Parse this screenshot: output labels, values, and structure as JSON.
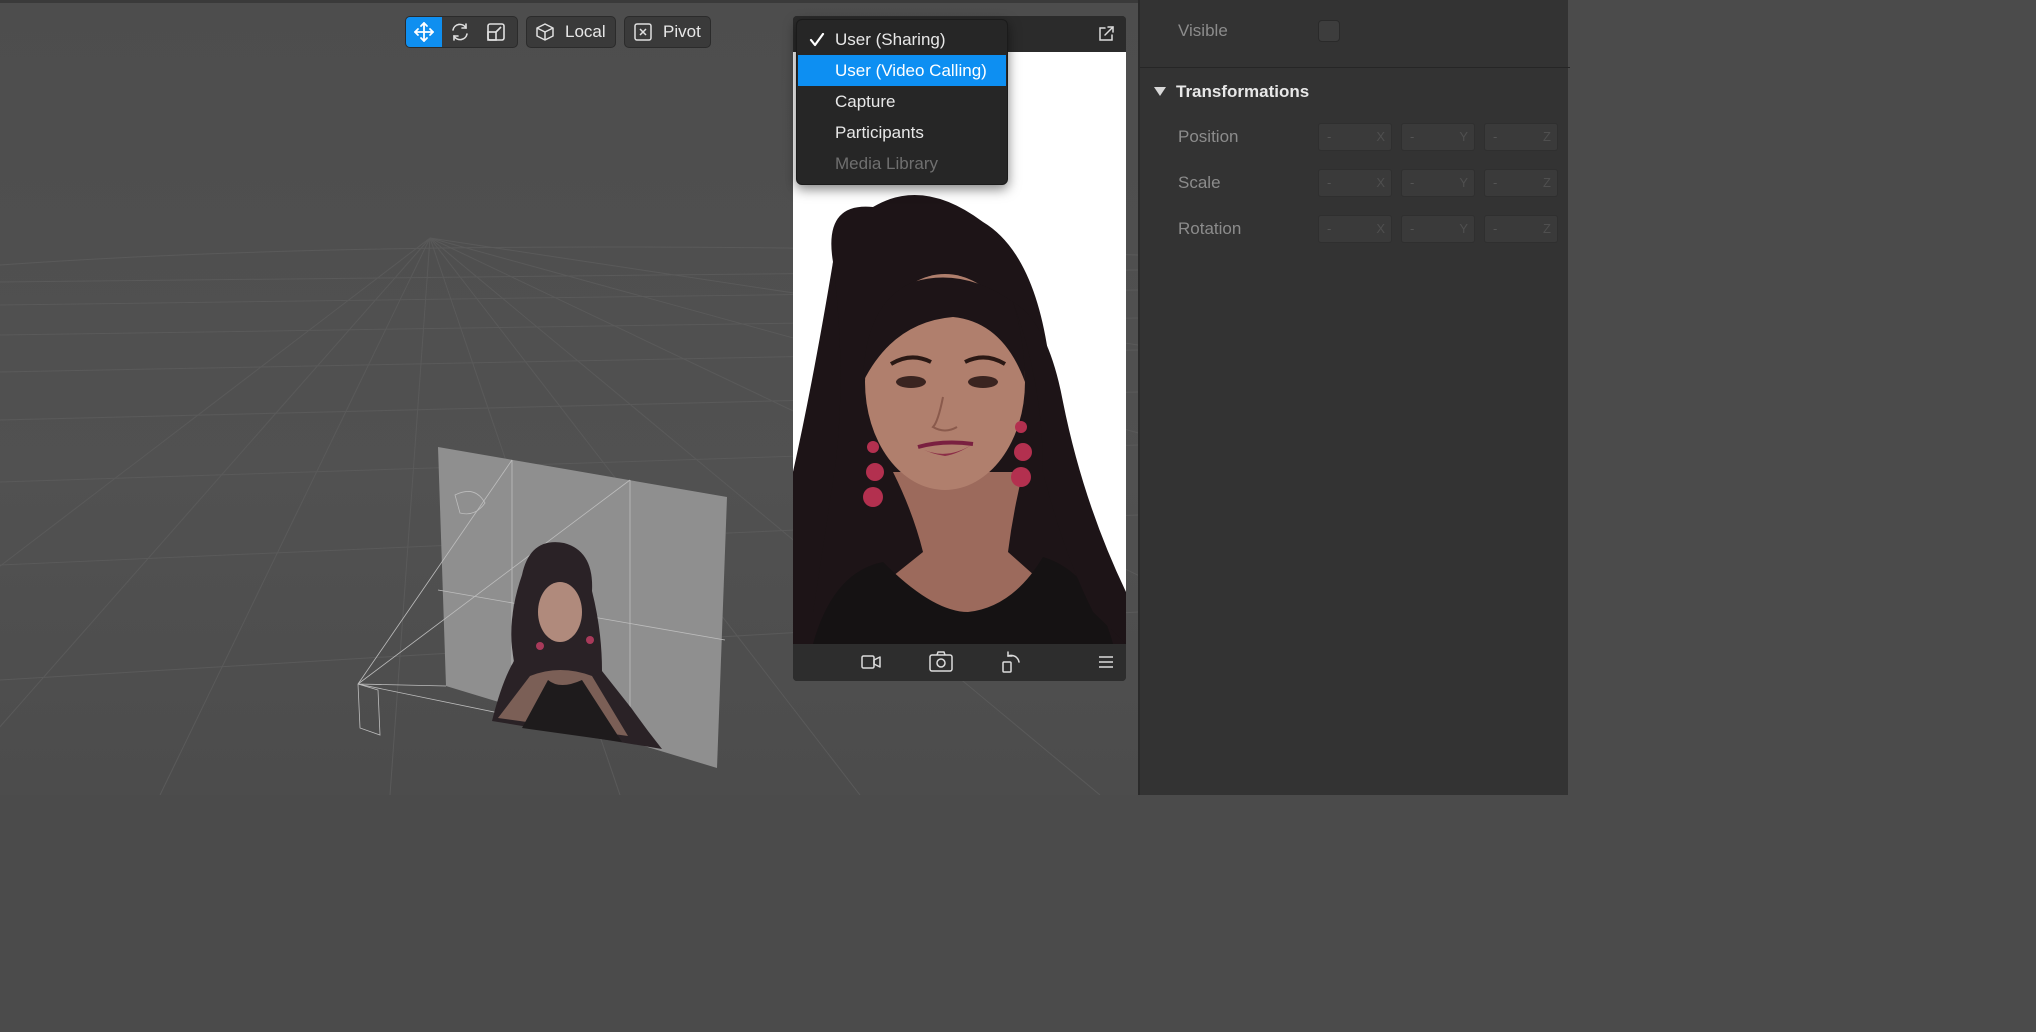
{
  "toolbar": {
    "tools": [
      {
        "name": "move-tool",
        "icon": "move-arrows-icon",
        "active": true
      },
      {
        "name": "rotate-tool",
        "icon": "rotate-icon",
        "active": false
      },
      {
        "name": "scale-tool",
        "icon": "scale-icon",
        "active": false
      }
    ],
    "space_label": "Local",
    "space_icon": "cube-icon",
    "pivot_label": "Pivot",
    "pivot_icon": "pivot-box-icon"
  },
  "preview": {
    "header_icon": "pop-out-icon",
    "footer_icons": [
      "video-camera-icon",
      "camera-switch-icon",
      "rotate-device-icon",
      "hamburger-menu-icon"
    ]
  },
  "source_menu": {
    "items": [
      {
        "label": "User (Sharing)",
        "checked": true,
        "highlighted": false,
        "disabled": false
      },
      {
        "label": "User (Video Calling)",
        "checked": false,
        "highlighted": true,
        "disabled": false
      },
      {
        "label": "Capture",
        "checked": false,
        "highlighted": false,
        "disabled": false
      },
      {
        "label": "Participants",
        "checked": false,
        "highlighted": false,
        "disabled": false
      },
      {
        "label": "Media Library",
        "checked": false,
        "highlighted": false,
        "disabled": true
      }
    ]
  },
  "inspector": {
    "visible_label": "Visible",
    "visible_checked": false,
    "section_title": "Transformations",
    "rows": [
      {
        "label": "Position",
        "x": "-",
        "y": "-",
        "z": "-"
      },
      {
        "label": "Scale",
        "x": "-",
        "y": "-",
        "z": "-"
      },
      {
        "label": "Rotation",
        "x": "-",
        "y": "-",
        "z": "-"
      }
    ],
    "axis_labels": [
      "X",
      "Y",
      "Z"
    ]
  },
  "colors": {
    "accent": "#0f8ff0",
    "viewport_bg": "#4d4d4d",
    "panel_bg": "#333333"
  }
}
